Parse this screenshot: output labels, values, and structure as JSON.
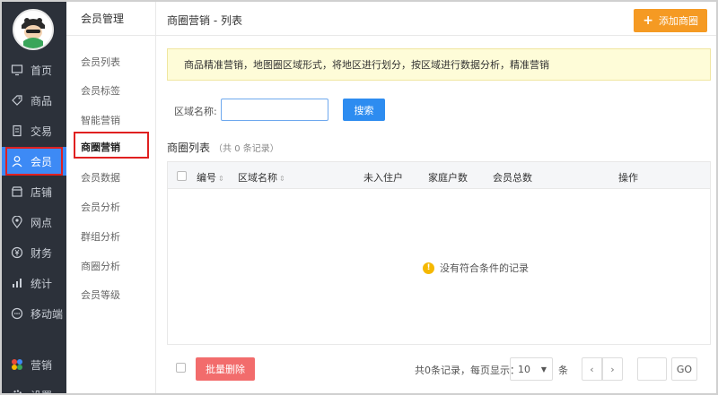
{
  "nav": {
    "items": [
      {
        "label": "首页",
        "icon": "monitor-icon"
      },
      {
        "label": "商品",
        "icon": "tag-icon"
      },
      {
        "label": "交易",
        "icon": "receipt-icon"
      },
      {
        "label": "会员",
        "icon": "user-icon",
        "active": true
      },
      {
        "label": "店铺",
        "icon": "store-icon"
      },
      {
        "label": "网点",
        "icon": "location-icon"
      },
      {
        "label": "财务",
        "icon": "yen-icon"
      },
      {
        "label": "统计",
        "icon": "bar-chart-icon"
      },
      {
        "label": "移动端",
        "icon": "chat-icon"
      },
      {
        "label": "营销",
        "icon": "flower-icon"
      },
      {
        "label": "设置",
        "icon": "gear-icon"
      }
    ]
  },
  "subnav": {
    "title": "会员管理",
    "items": [
      {
        "label": "会员列表"
      },
      {
        "label": "会员标签"
      },
      {
        "label": "智能营销"
      },
      {
        "label": "商圈营销",
        "active": true
      },
      {
        "label": "会员数据"
      },
      {
        "label": "会员分析"
      },
      {
        "label": "群组分析"
      },
      {
        "label": "商圈分析"
      },
      {
        "label": "会员等级"
      }
    ]
  },
  "header": {
    "breadcrumb": "商圈营销 - 列表",
    "add_label": "添加商圈"
  },
  "notice": "商品精准营销，地图圈区域形式，将地区进行划分，按区域进行数据分析，精准营销",
  "search": {
    "label": "区域名称:",
    "value": "",
    "button": "搜索"
  },
  "list": {
    "title": "商圈列表",
    "count": "（共 0 条记录）",
    "columns": [
      "编号",
      "区域名称",
      "未入住户",
      "家庭户数",
      "会员总数",
      "操作"
    ],
    "rows": [],
    "empty_text": "没有符合条件的记录"
  },
  "footer": {
    "batch_delete": "批量删除",
    "page_info": "共0条记录，每页显示：",
    "page_size": "10",
    "page_unit": "条",
    "prev": "‹",
    "next": "›",
    "go": "GO"
  },
  "colors": {
    "nav_bg": "#2c313a",
    "active_blue": "#3d8af5",
    "orange": "#f59a23",
    "danger": "#f26c6c",
    "highlight": "#e02020"
  }
}
